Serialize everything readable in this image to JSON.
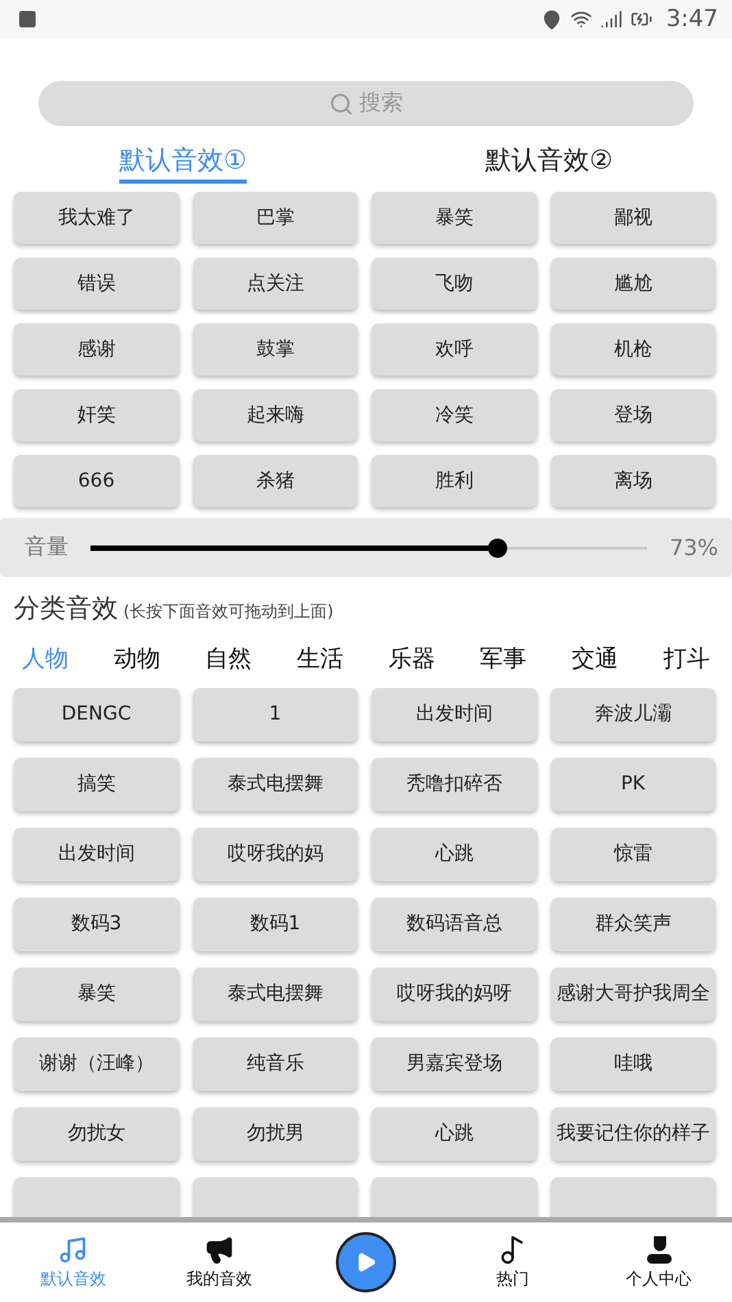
{
  "status_bar": {
    "time": "3:47"
  },
  "search": {
    "placeholder": "搜索"
  },
  "tabs": [
    {
      "label": "默认音效①",
      "selected": true
    },
    {
      "label": "默认音效②",
      "selected": false
    }
  ],
  "default_sounds": [
    "我太难了",
    "巴掌",
    "暴笑",
    "鄙视",
    "错误",
    "点关注",
    "飞吻",
    "尴尬",
    "感谢",
    "鼓掌",
    "欢呼",
    "机枪",
    "奸笑",
    "起来嗨",
    "冷笑",
    "登场",
    "666",
    "杀猪",
    "胜利",
    "离场"
  ],
  "volume": {
    "label": "音量",
    "level": 0.73,
    "reading": "73%"
  },
  "category_section": {
    "title": "分类音效",
    "hint": "(长按下面音效可拖动到上面)"
  },
  "categories": [
    {
      "label": "人物",
      "selected": true
    },
    {
      "label": "动物",
      "selected": false
    },
    {
      "label": "自然",
      "selected": false
    },
    {
      "label": "生活",
      "selected": false
    },
    {
      "label": "乐器",
      "selected": false
    },
    {
      "label": "军事",
      "selected": false
    },
    {
      "label": "交通",
      "selected": false
    },
    {
      "label": "打斗",
      "selected": false
    }
  ],
  "category_sounds": [
    "DENGC",
    "1",
    "出发时间",
    "奔波儿灞",
    "搞笑",
    "泰式电摆舞",
    "秃噜扣碎否",
    "PK",
    "出发时间",
    "哎呀我的妈",
    "心跳",
    "惊雷",
    "数码3",
    "数码1",
    "数码语音总",
    "群众笑声",
    "暴笑",
    "泰式电摆舞",
    "哎呀我的妈呀",
    "感谢大哥护我周全",
    "谢谢（汪峰）",
    "纯音乐",
    "男嘉宾登场",
    "哇哦",
    "勿扰女",
    "勿扰男",
    "心跳",
    "我要记住你的样子"
  ],
  "bottom_nav": [
    {
      "kind": "notes",
      "label": "默认音效",
      "selected": true
    },
    {
      "kind": "megaphone",
      "label": "我的音效",
      "selected": false
    },
    {
      "kind": "play"
    },
    {
      "kind": "note",
      "label": "热门",
      "selected": false
    },
    {
      "kind": "person",
      "label": "个人中心",
      "selected": false
    }
  ]
}
